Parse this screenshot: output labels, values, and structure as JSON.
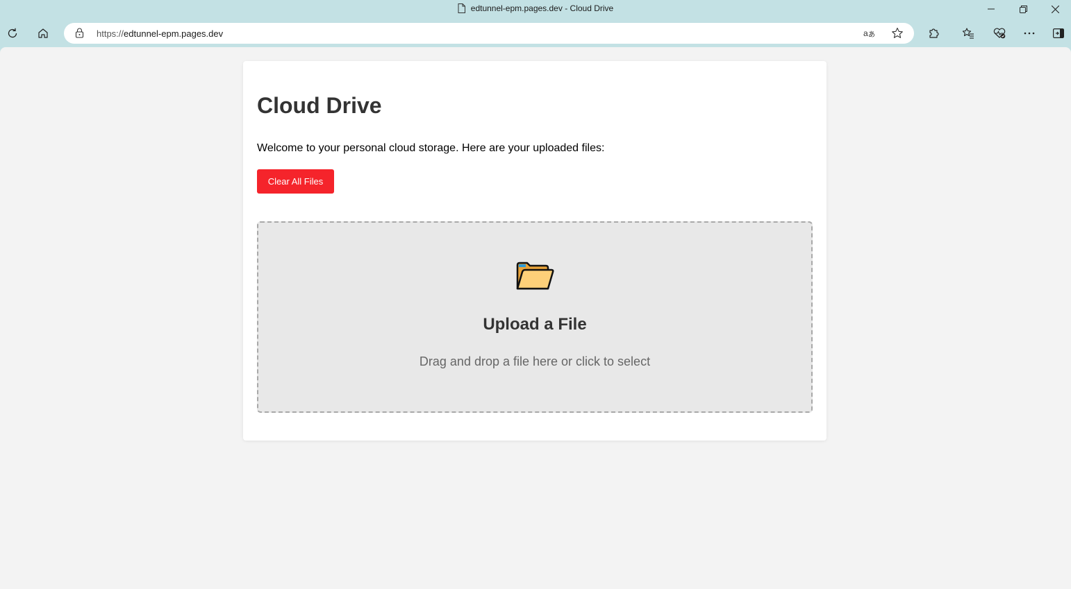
{
  "browser": {
    "window_title": "edtunnel-epm.pages.dev - Cloud Drive",
    "url_protocol": "https://",
    "url_host": "edtunnel-epm.pages.dev"
  },
  "page": {
    "heading": "Cloud Drive",
    "welcome_text": "Welcome to your personal cloud storage. Here are your uploaded files:",
    "clear_button_label": "Clear All Files",
    "upload": {
      "title": "Upload a File",
      "subtitle": "Drag and drop a file here or click to select",
      "icon": "folder-icon"
    }
  },
  "colors": {
    "browser_frame": "#c3e1e4",
    "page_background": "#f3f3f3",
    "danger_button": "#f5242b",
    "dropzone_background": "#e8e8e8"
  }
}
